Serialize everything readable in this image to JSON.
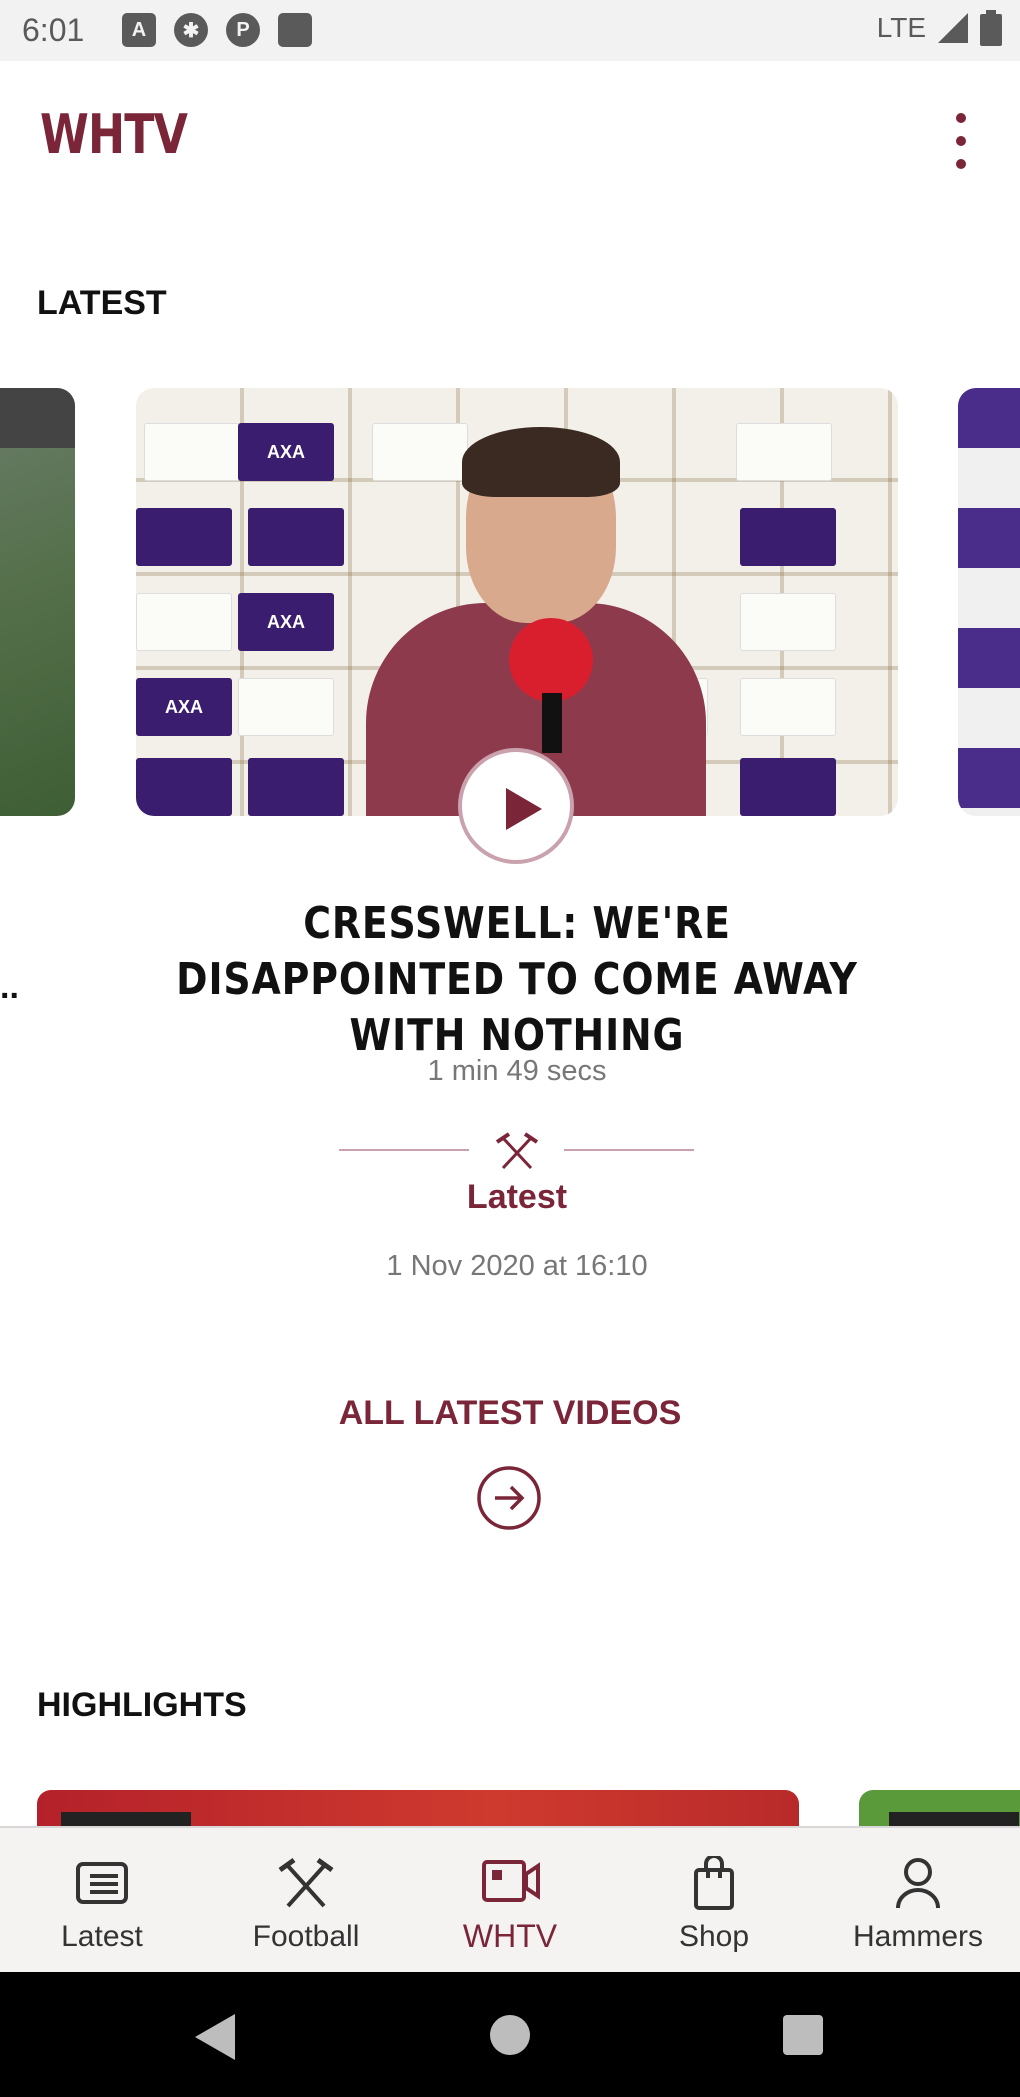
{
  "status_bar": {
    "time": "6:01",
    "network": "LTE",
    "icons": [
      "a-icon",
      "gear-icon",
      "p-icon",
      "sd-card-icon",
      "signal-icon",
      "battery-icon"
    ]
  },
  "app_bar": {
    "title": "WHTV",
    "menu_icon": "more-vert-icon"
  },
  "latest": {
    "section_title": "LATEST",
    "featured_video": {
      "title": "CRESSWELL: WE'RE DISAPPOINTED TO COME AWAY WITH NOTHING",
      "duration": "1 min 49 secs",
      "category": "Latest",
      "date": "1 Nov 2020 at 16:10"
    },
    "all_videos_label": "ALL LATEST VIDEOS",
    "prev_card_ellipsis": ".."
  },
  "highlights": {
    "section_title": "HIGHLIGHTS"
  },
  "bottom_nav": {
    "items": [
      {
        "label": "Latest",
        "icon": "news-icon"
      },
      {
        "label": "Football",
        "icon": "crossed-hammers-icon"
      },
      {
        "label": "WHTV",
        "icon": "video-camera-icon",
        "active": true
      },
      {
        "label": "Shop",
        "icon": "shopping-bag-icon"
      },
      {
        "label": "Hammers",
        "icon": "person-icon"
      }
    ]
  },
  "colors": {
    "brand": "#7a2538",
    "divider": "#c9a2ad"
  }
}
